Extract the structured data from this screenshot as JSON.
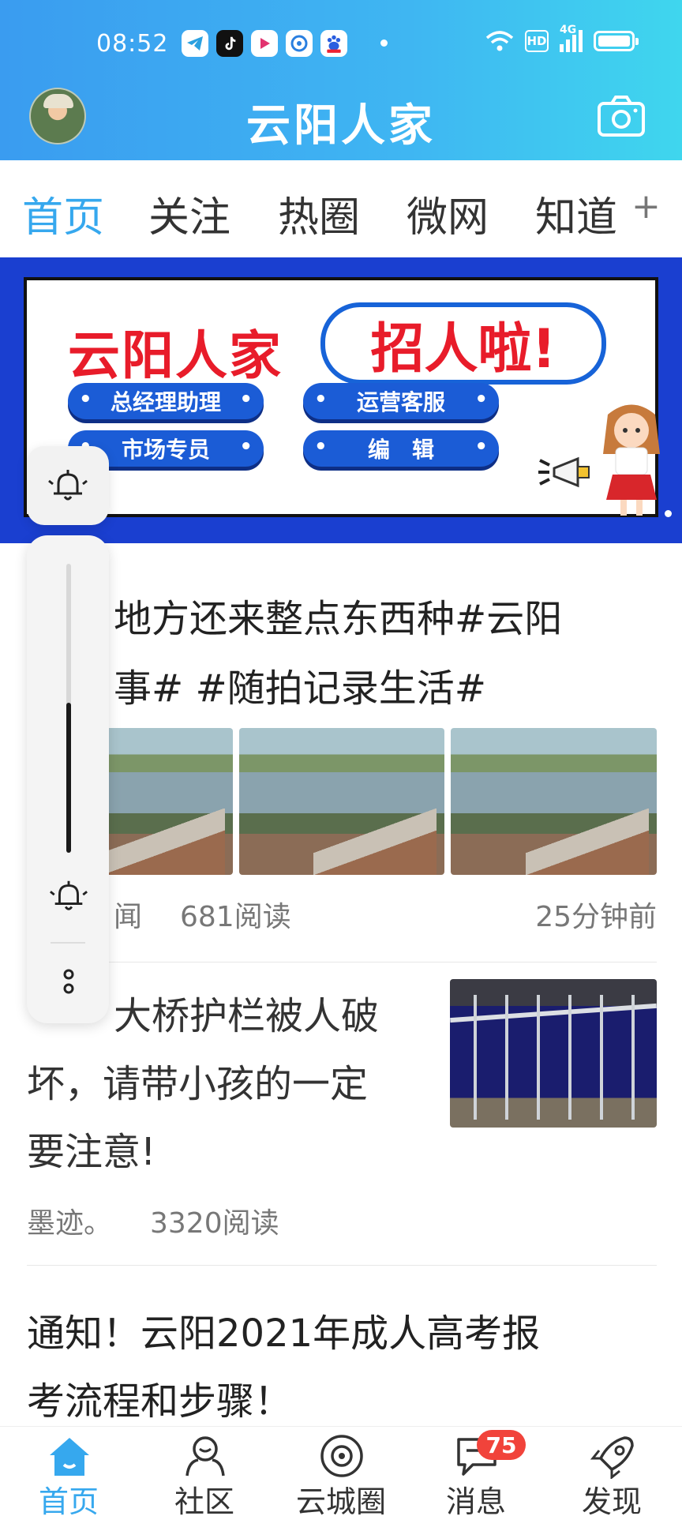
{
  "status_bar": {
    "time": "08:52",
    "hd": "HD",
    "network": "4G",
    "app_icons": [
      "telegram-icon",
      "tiktok-icon",
      "youku-icon",
      "browser-icon",
      "baidu-icon"
    ]
  },
  "header": {
    "title": "云阳人家"
  },
  "tabs": [
    {
      "label": "首页",
      "active": true
    },
    {
      "label": "关注",
      "active": false
    },
    {
      "label": "热圈",
      "active": false
    },
    {
      "label": "微网",
      "active": false
    },
    {
      "label": "知道",
      "active": false
    }
  ],
  "tab_add": "+",
  "banner": {
    "title": "云阳人家",
    "callout": "招人啦!",
    "positions": [
      "总经理助理",
      "运营客服",
      "市场专员",
      "编　辑"
    ]
  },
  "feed": [
    {
      "title": "…地方还来整点东西种#云阳…事# #随拍记录生活#",
      "title_line1": "地方还来整点东西种#云阳",
      "title_line2": "事# #随拍记录生活#",
      "source": "闻",
      "reads": "681阅读",
      "time": "25分钟前"
    },
    {
      "title_line1": "大桥护栏被人破",
      "title_line2": "坏，请带小孩的一定",
      "title_line3": "要注意!",
      "source": "墨迹。",
      "reads": "3320阅读"
    },
    {
      "title_line1": "通知！云阳2021年成人高考报",
      "title_line2": "考流程和步骤！"
    }
  ],
  "bottom_nav": [
    {
      "label": "首页",
      "icon": "home-icon",
      "active": true
    },
    {
      "label": "社区",
      "icon": "community-icon",
      "active": false
    },
    {
      "label": "云城圈",
      "icon": "circle-icon",
      "active": false
    },
    {
      "label": "消息",
      "icon": "message-icon",
      "active": false,
      "badge": "75"
    },
    {
      "label": "发现",
      "icon": "rocket-icon",
      "active": false
    }
  ],
  "ringer": {
    "volume_fraction": 0.52
  },
  "colors": {
    "accent": "#36a8ee",
    "badge": "#f1433b",
    "banner_red": "#e81c2a",
    "banner_blue": "#1b5cd6"
  }
}
